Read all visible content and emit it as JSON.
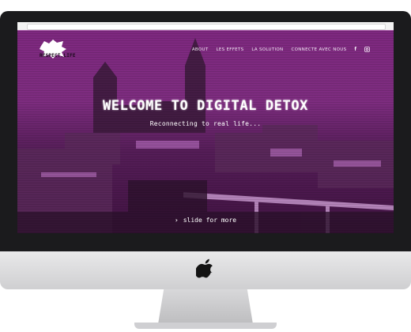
{
  "site": {
    "logo_text": "RESPECT.LIFE",
    "nav": [
      {
        "label": "ABOUT"
      },
      {
        "label": "LES EFFETS"
      },
      {
        "label": "LA SOLUTION"
      },
      {
        "label": "CONNECTE AVEC NOUS"
      }
    ],
    "social_icons": [
      "facebook-icon",
      "instagram-icon"
    ],
    "hero": {
      "title": "WELCOME TO DIGITAL DETOX",
      "subtitle": "Reconnecting to real life...",
      "cta": "slide for more"
    }
  },
  "colors": {
    "accent": "#b04bb5",
    "overlay": "#9a309a",
    "device_bezel": "#1b1b1d",
    "device_chin": "#dcdcde"
  }
}
